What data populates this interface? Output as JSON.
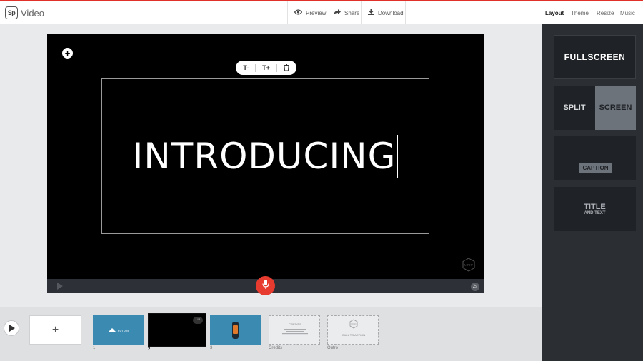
{
  "app": {
    "logo_text": "Sp",
    "title": "Video"
  },
  "toolbar": {
    "preview": "Preview",
    "share": "Share",
    "download": "Download"
  },
  "tabs": {
    "layout": "Layout",
    "theme": "Theme",
    "resize": "Resize",
    "music": "Music",
    "active": "Layout"
  },
  "canvas": {
    "headline": "INTRODUCING",
    "logo_badge": "LOGO",
    "duration": "2s"
  },
  "text_toolbar": {
    "decrease": "T-",
    "increase": "T+"
  },
  "layouts": {
    "fullscreen": "FULLSCREEN",
    "split_left": "SPLIT",
    "split_right": "SCREEN",
    "caption": "CAPTION",
    "title_main": "TITLE",
    "title_sub": "AND TEXT"
  },
  "timeline": {
    "scenes": [
      {
        "label": "1",
        "caption": "FUTURE"
      },
      {
        "label": "2",
        "active": true
      },
      {
        "label": "3"
      },
      {
        "label": "Credits",
        "caption": "CREDITS"
      },
      {
        "label": "Outro",
        "caption": "CALL TO ACTION",
        "badge": "LOGO"
      }
    ]
  },
  "colors": {
    "accent": "#e0302a",
    "mic": "#e83b2f",
    "panel": "#2b2e33",
    "scene_blue": "#3a8ab2"
  },
  "icons": [
    "eye-icon",
    "share-arrow-icon",
    "download-icon",
    "plus-icon",
    "trash-icon",
    "microphone-icon",
    "play-icon",
    "more-dots-icon"
  ]
}
